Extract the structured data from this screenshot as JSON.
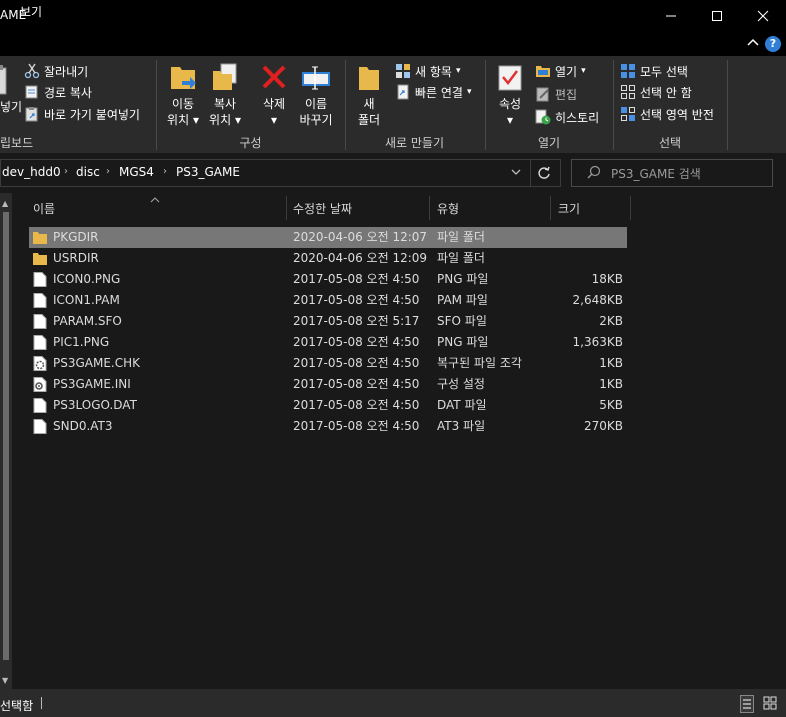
{
  "window": {
    "title": "AME"
  },
  "menu": {
    "tab_view": "보기"
  },
  "ribbon": {
    "clipboard": {
      "cut": "잘라내기",
      "copy_path": "경로 복사",
      "paste_shortcut": "바로 가기 붙여넣기",
      "paste_partial": "넣기",
      "group_label": "립보드"
    },
    "organize": {
      "move_to_l1": "이동",
      "move_to_l2": "위치",
      "copy_to_l1": "복사",
      "copy_to_l2": "위치",
      "delete": "삭제",
      "rename_l1": "이름",
      "rename_l2": "바꾸기",
      "group_label": "구성"
    },
    "new": {
      "new_folder_l1": "새",
      "new_folder_l2": "폴더",
      "new_item": "새 항목",
      "easy_access": "빠른 연결",
      "group_label": "새로 만들기"
    },
    "open": {
      "properties": "속성",
      "open": "열기",
      "edit": "편집",
      "history": "히스토리",
      "group_label": "열기"
    },
    "select": {
      "select_all": "모두 선택",
      "select_none": "선택 안 함",
      "invert_selection": "선택 영역 반전",
      "group_label": "선택"
    }
  },
  "address": {
    "crumbs": [
      "dev_hdd0",
      "disc",
      "MGS4",
      "PS3_GAME"
    ],
    "search_placeholder": "PS3_GAME 검색"
  },
  "columns": {
    "name": "이름",
    "date": "수정한 날짜",
    "type": "유형",
    "size": "크기"
  },
  "files": [
    {
      "name": "PKGDIR",
      "date": "2020-04-06 오전 12:07",
      "type": "파일 폴더",
      "size": "",
      "icon": "folder-icon",
      "selected": true
    },
    {
      "name": "USRDIR",
      "date": "2020-04-06 오전 12:09",
      "type": "파일 폴더",
      "size": "",
      "icon": "folder-icon"
    },
    {
      "name": "ICON0.PNG",
      "date": "2017-05-08 오전 4:50",
      "type": "PNG 파일",
      "size": "18KB",
      "icon": "file-icon"
    },
    {
      "name": "ICON1.PAM",
      "date": "2017-05-08 오전 4:50",
      "type": "PAM 파일",
      "size": "2,648KB",
      "icon": "file-icon"
    },
    {
      "name": "PARAM.SFO",
      "date": "2017-05-08 오전 5:17",
      "type": "SFO 파일",
      "size": "2KB",
      "icon": "file-icon"
    },
    {
      "name": "PIC1.PNG",
      "date": "2017-05-08 오전 4:50",
      "type": "PNG 파일",
      "size": "1,363KB",
      "icon": "file-icon"
    },
    {
      "name": "PS3GAME.CHK",
      "date": "2017-05-08 오전 4:50",
      "type": "복구된 파일 조각",
      "size": "1KB",
      "icon": "chk-file-icon"
    },
    {
      "name": "PS3GAME.INI",
      "date": "2017-05-08 오전 4:50",
      "type": "구성 설정",
      "size": "1KB",
      "icon": "ini-file-icon"
    },
    {
      "name": "PS3LOGO.DAT",
      "date": "2017-05-08 오전 4:50",
      "type": "DAT 파일",
      "size": "5KB",
      "icon": "file-icon"
    },
    {
      "name": "SND0.AT3",
      "date": "2017-05-08 오전 4:50",
      "type": "AT3 파일",
      "size": "270KB",
      "icon": "file-icon"
    }
  ],
  "status": {
    "text": "선택함"
  },
  "colors": {
    "folder": "#e8b84a",
    "selection": "#777777",
    "accent": "#2f7fd6"
  }
}
